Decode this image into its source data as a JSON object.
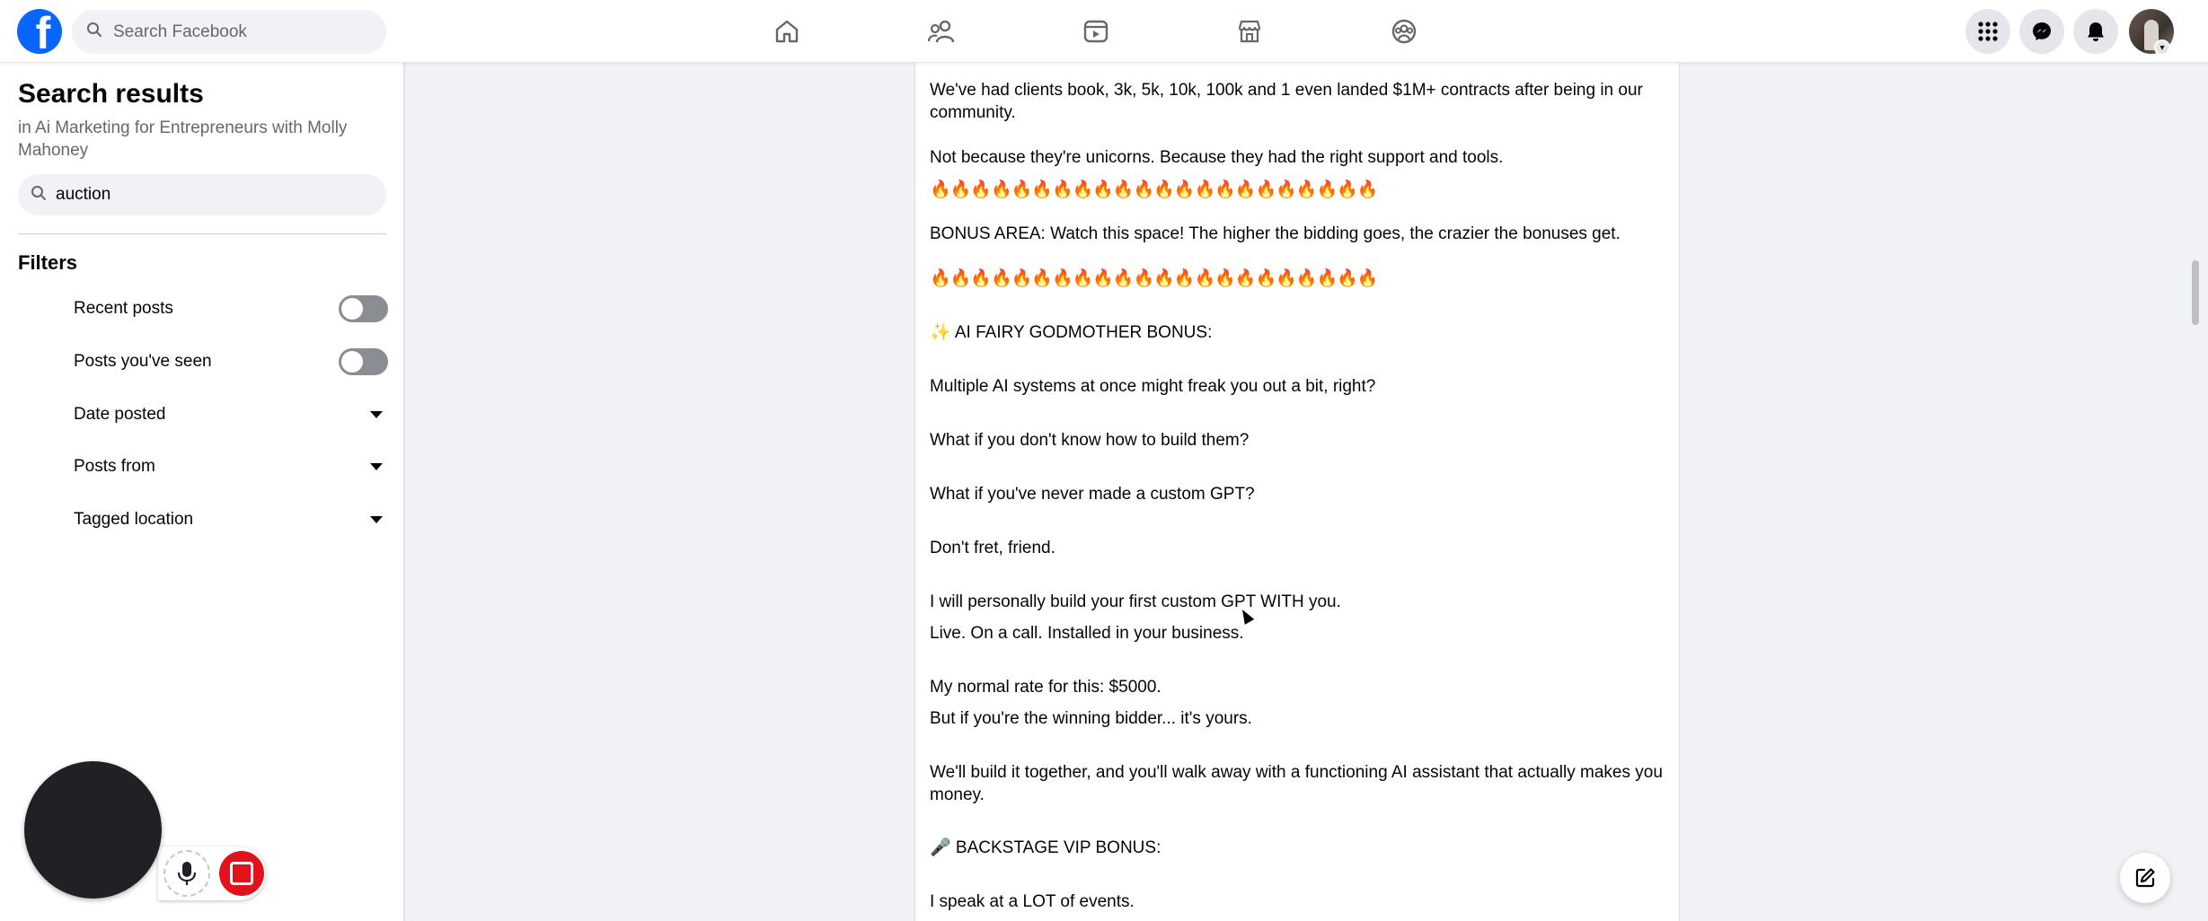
{
  "topbar": {
    "logo_letter": "f",
    "search_placeholder": "Search Facebook",
    "nav": [
      "home-icon",
      "friends-icon",
      "video-icon",
      "marketplace-icon",
      "groups-icon"
    ],
    "right": [
      "menu-grid-icon",
      "messenger-icon",
      "notifications-icon"
    ],
    "brand_color": "#0866ff"
  },
  "sidebar": {
    "title": "Search results",
    "subtitle": "in Ai Marketing for Entrepreneurs with Molly Mahoney",
    "search_value": "auction",
    "filters_heading": "Filters",
    "filters": [
      {
        "label": "Recent posts",
        "control": "toggle",
        "on": false
      },
      {
        "label": "Posts you've seen",
        "control": "toggle",
        "on": false
      },
      {
        "label": "Date posted",
        "control": "dropdown"
      },
      {
        "label": "Posts from",
        "control": "dropdown"
      },
      {
        "label": "Tagged location",
        "control": "dropdown"
      }
    ]
  },
  "post": {
    "lines": [
      "We've had clients book, 3k, 5k, 10k, 100k and 1 even landed $1M+ contracts after being in our community.",
      "Not because they're unicorns. Because they had the right support and tools.",
      "🔥🔥🔥🔥🔥🔥🔥🔥🔥🔥🔥🔥🔥🔥🔥🔥🔥🔥🔥🔥🔥🔥",
      "BONUS AREA: Watch this space! The higher the bidding goes, the crazier the bonuses get.",
      "🔥🔥🔥🔥🔥🔥🔥🔥🔥🔥🔥🔥🔥🔥🔥🔥🔥🔥🔥🔥🔥🔥",
      "✨ AI FAIRY GODMOTHER BONUS:",
      "Multiple AI systems at once might freak you out a bit, right?",
      "What if you don't know how to build them?",
      "What if you've never made a custom GPT?",
      "Don't fret, friend.",
      "I will personally build your first custom GPT WITH you.",
      "Live. On a call. Installed in your business.",
      "My normal rate for this: $5000.",
      "But if you're the winning bidder... it's yours.",
      "We'll build it together, and you'll walk away with a functioning AI assistant that actually makes you money.",
      "🎤 BACKSTAGE VIP BONUS:",
      "I speak at a LOT of events."
    ]
  }
}
